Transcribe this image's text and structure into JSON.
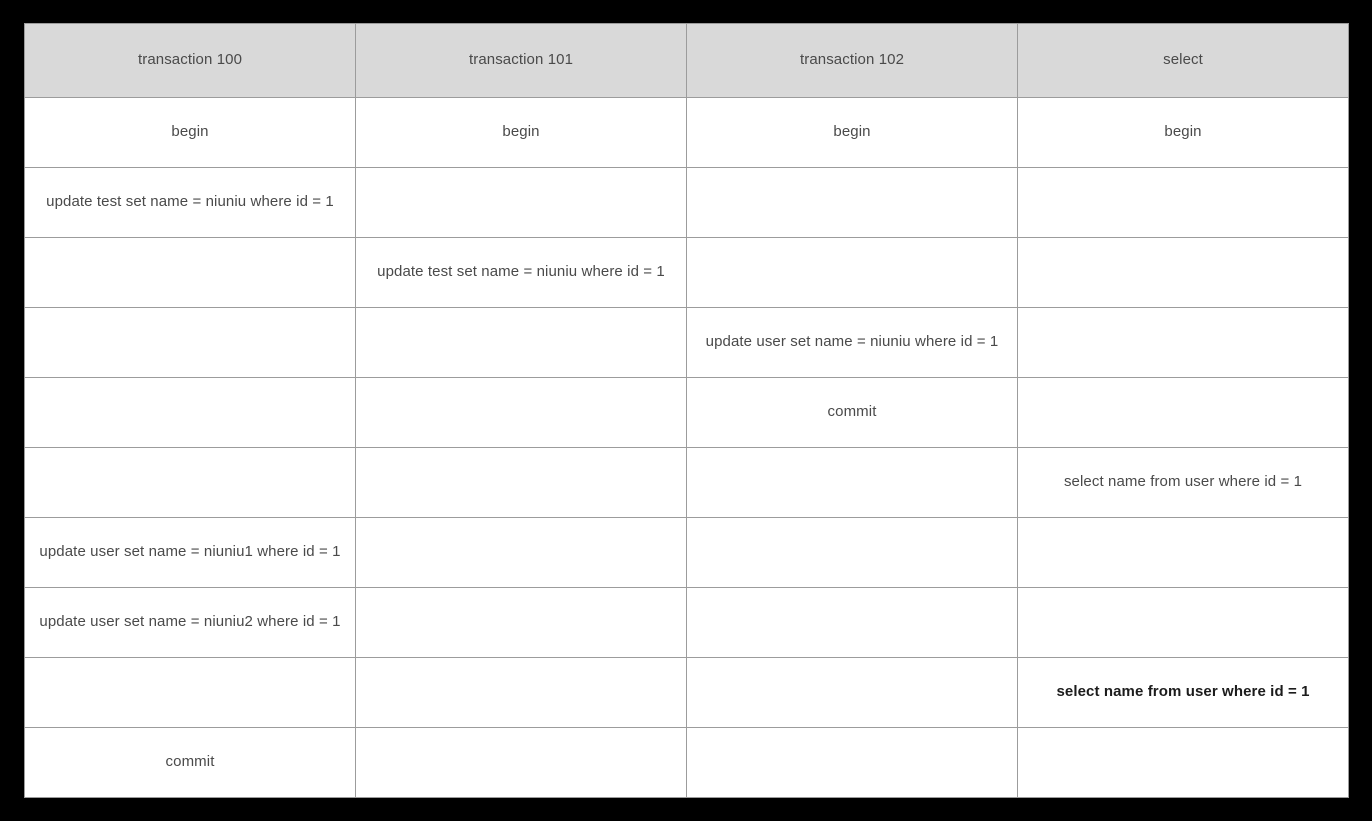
{
  "table": {
    "columns": [
      {
        "id": "txn-100",
        "label": "transaction  100"
      },
      {
        "id": "txn-101",
        "label": "transaction  101"
      },
      {
        "id": "txn-102",
        "label": "transaction  102"
      },
      {
        "id": "select",
        "label": "select"
      }
    ],
    "rows": [
      {
        "index": 0,
        "cells": [
          {
            "text": "begin",
            "style": "normal"
          },
          {
            "text": "begin",
            "style": "normal"
          },
          {
            "text": "begin",
            "style": "normal"
          },
          {
            "text": "begin",
            "style": "normal"
          }
        ]
      },
      {
        "index": 1,
        "cells": [
          {
            "text": "update test set name = niuniu where id = 1",
            "style": "normal"
          },
          {
            "text": "",
            "style": "empty"
          },
          {
            "text": "",
            "style": "empty"
          },
          {
            "text": "",
            "style": "empty"
          }
        ]
      },
      {
        "index": 2,
        "cells": [
          {
            "text": "",
            "style": "empty"
          },
          {
            "text": "update test set name = niuniu where id = 1",
            "style": "normal"
          },
          {
            "text": "",
            "style": "empty"
          },
          {
            "text": "",
            "style": "empty"
          }
        ]
      },
      {
        "index": 3,
        "cells": [
          {
            "text": "",
            "style": "empty"
          },
          {
            "text": "",
            "style": "empty"
          },
          {
            "text": "update user set name = niuniu where id = 1",
            "style": "normal"
          },
          {
            "text": "",
            "style": "empty"
          }
        ]
      },
      {
        "index": 4,
        "cells": [
          {
            "text": "",
            "style": "empty"
          },
          {
            "text": "",
            "style": "empty"
          },
          {
            "text": "commit",
            "style": "normal"
          },
          {
            "text": "",
            "style": "empty"
          }
        ]
      },
      {
        "index": 5,
        "cells": [
          {
            "text": "",
            "style": "empty"
          },
          {
            "text": "",
            "style": "empty"
          },
          {
            "text": "",
            "style": "empty"
          },
          {
            "text": "select name from user where id = 1",
            "style": "normal"
          }
        ]
      },
      {
        "index": 6,
        "cells": [
          {
            "text": "update user set name = niuniu1 where id = 1",
            "style": "normal"
          },
          {
            "text": "",
            "style": "empty"
          },
          {
            "text": "",
            "style": "empty"
          },
          {
            "text": "",
            "style": "empty"
          }
        ]
      },
      {
        "index": 7,
        "cells": [
          {
            "text": "update user set name = niuniu2 where id = 1",
            "style": "normal"
          },
          {
            "text": "",
            "style": "empty"
          },
          {
            "text": "",
            "style": "empty"
          },
          {
            "text": "",
            "style": "empty"
          }
        ]
      },
      {
        "index": 8,
        "cells": [
          {
            "text": "",
            "style": "empty"
          },
          {
            "text": "",
            "style": "empty"
          },
          {
            "text": "",
            "style": "empty"
          },
          {
            "text": "select name from user where id = 1",
            "style": "highlight"
          }
        ]
      },
      {
        "index": 9,
        "cells": [
          {
            "text": "commit",
            "style": "normal"
          },
          {
            "text": "",
            "style": "empty"
          },
          {
            "text": "",
            "style": "empty"
          },
          {
            "text": "",
            "style": "empty"
          }
        ]
      }
    ]
  },
  "colors": {
    "page_background": "#000000",
    "table_background": "#ffffff",
    "header_background": "#d9d9d9",
    "border": "#9c9c9c",
    "text": "#4a4a4a",
    "highlight_text": "#1c1c1c"
  }
}
